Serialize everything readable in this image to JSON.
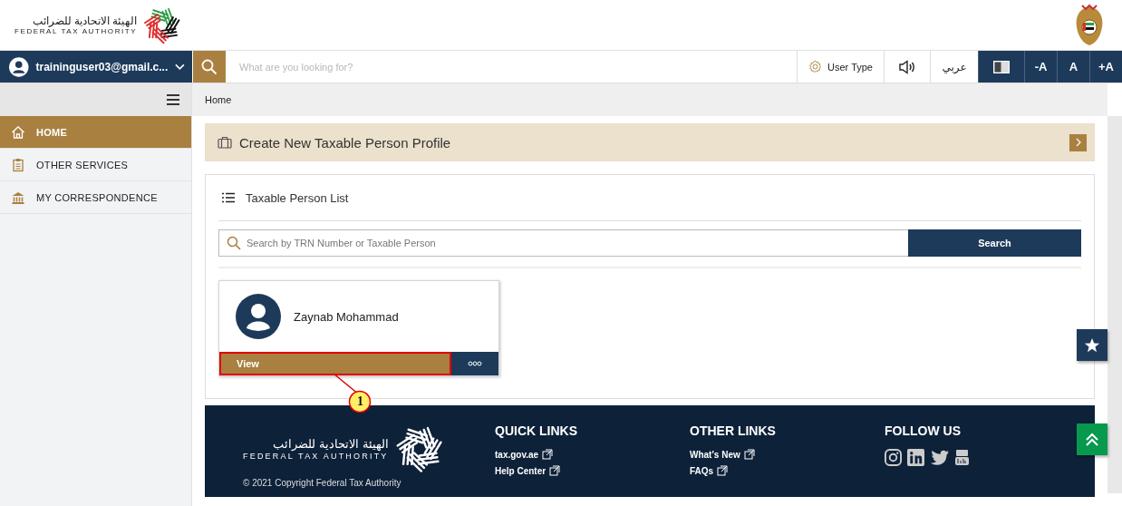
{
  "header": {
    "logo_arabic": "الهيئة الاتحادية للضرائب",
    "logo_english": "FEDERAL TAX AUTHORITY"
  },
  "toolbar": {
    "user": "traininguser03@gmail.c...",
    "search": {
      "placeholder": "What are you looking for?"
    },
    "user_type": "User Type",
    "language": "عربي",
    "font_buttons": [
      "-A",
      "A",
      "+A"
    ]
  },
  "sidebar": {
    "items": [
      {
        "label": "HOME",
        "kind": "home",
        "selected": true
      },
      {
        "label": "OTHER SERVICES",
        "kind": "clipboard",
        "selected": false
      },
      {
        "label": "MY CORRESPONDENCE",
        "kind": "building",
        "selected": false
      }
    ]
  },
  "breadcrumb": [
    "Home"
  ],
  "banner": {
    "title": "Create New Taxable Person Profile"
  },
  "list": {
    "title": "Taxable Person List",
    "search": {
      "placeholder": "Search by TRN Number or Taxable Person"
    },
    "search_button": "Search",
    "persons": [
      {
        "name": "Zaynab Mohammad",
        "action": "View",
        "highlighted": true
      }
    ]
  },
  "callout": {
    "label": "1"
  },
  "footer": {
    "logo_arabic": "الهيئة الاتحادية للضرائب",
    "logo_english": "FEDERAL TAX AUTHORITY",
    "columns": [
      {
        "title": "QUICK LINKS",
        "links": [
          "tax.gov.ae",
          "Help Center"
        ]
      },
      {
        "title": "OTHER LINKS",
        "links": [
          "What's New",
          "FAQs"
        ]
      },
      {
        "title": "FOLLOW US"
      }
    ],
    "copyright": "© 2021 Copyright Federal Tax Authority"
  }
}
